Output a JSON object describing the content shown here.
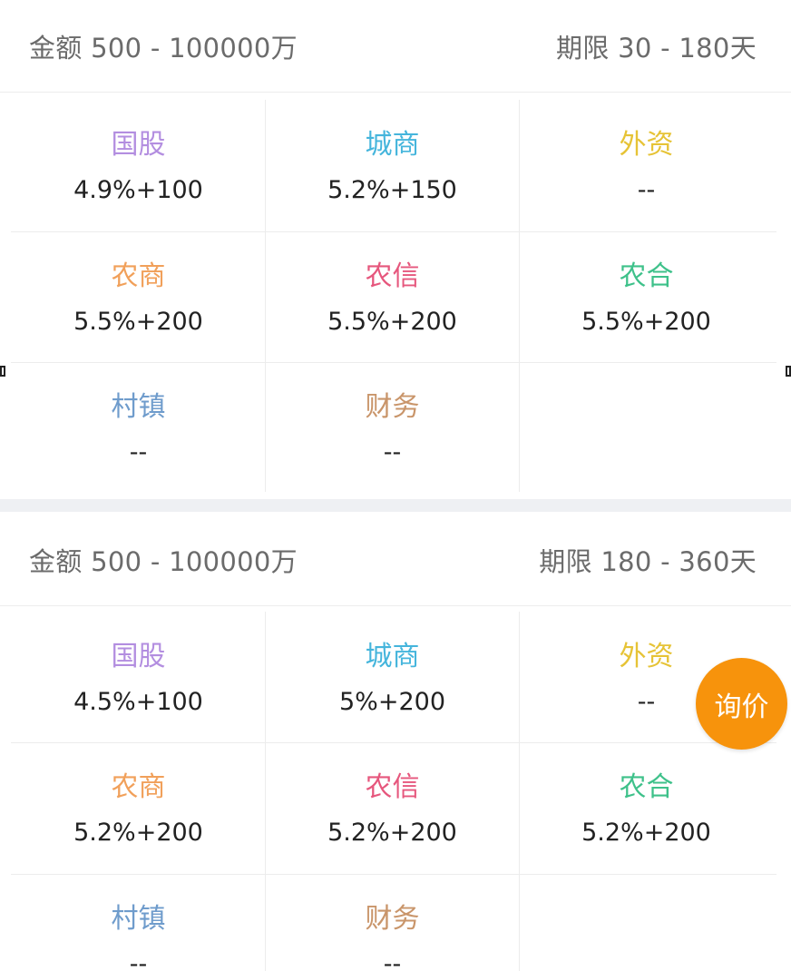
{
  "colors": {
    "guogu": "#b38ee0",
    "chengshang": "#45b5dc",
    "waizi": "#e6c336",
    "nongshang": "#f1a05a",
    "nongxin": "#e6577d",
    "nonghe": "#3ec18a",
    "cunzhen": "#6f9ccc",
    "caiwu": "#c9956a",
    "inquiry_bg": "#f7930c"
  },
  "cards": [
    {
      "amount": "金额 500 - 100000万",
      "term": "期限 30 - 180天",
      "items": [
        {
          "label": "国股",
          "value": "4.9%+100",
          "color_key": "guogu"
        },
        {
          "label": "城商",
          "value": "5.2%+150",
          "color_key": "chengshang"
        },
        {
          "label": "外资",
          "value": "--",
          "color_key": "waizi"
        },
        {
          "label": "农商",
          "value": "5.5%+200",
          "color_key": "nongshang"
        },
        {
          "label": "农信",
          "value": "5.5%+200",
          "color_key": "nongxin"
        },
        {
          "label": "农合",
          "value": "5.5%+200",
          "color_key": "nonghe"
        },
        {
          "label": "村镇",
          "value": "--",
          "color_key": "cunzhen"
        },
        {
          "label": "财务",
          "value": "--",
          "color_key": "caiwu"
        }
      ]
    },
    {
      "amount": "金额 500 - 100000万",
      "term": "期限 180 - 360天",
      "items": [
        {
          "label": "国股",
          "value": "4.5%+100",
          "color_key": "guogu"
        },
        {
          "label": "城商",
          "value": "5%+200",
          "color_key": "chengshang"
        },
        {
          "label": "外资",
          "value": "--",
          "color_key": "waizi"
        },
        {
          "label": "农商",
          "value": "5.2%+200",
          "color_key": "nongshang"
        },
        {
          "label": "农信",
          "value": "5.2%+200",
          "color_key": "nongxin"
        },
        {
          "label": "农合",
          "value": "5.2%+200",
          "color_key": "nonghe"
        },
        {
          "label": "村镇",
          "value": "--",
          "color_key": "cunzhen"
        },
        {
          "label": "财务",
          "value": "--",
          "color_key": "caiwu"
        }
      ]
    }
  ],
  "inquiry_button": {
    "label": "询价"
  }
}
